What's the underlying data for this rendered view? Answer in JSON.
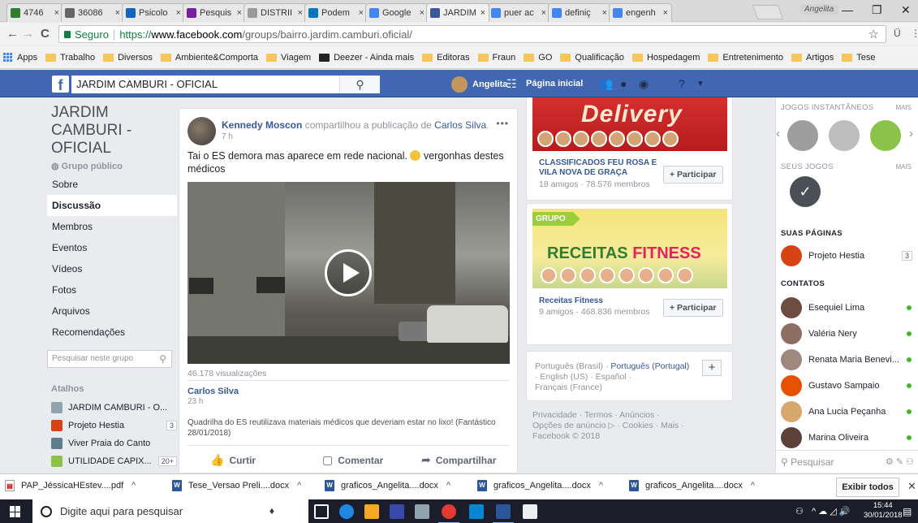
{
  "browser": {
    "tabs": [
      {
        "label": "4746",
        "color": "#2e7d32"
      },
      {
        "label": "36086",
        "color": "#666666"
      },
      {
        "label": "Psicolo",
        "color": "#1565c0"
      },
      {
        "label": "Pesquis",
        "color": "#7b1fa2"
      },
      {
        "label": "DISTRII",
        "color": "#999999"
      },
      {
        "label": "Podem",
        "color": "#0277bd"
      },
      {
        "label": "Google",
        "color": "#4285f4"
      },
      {
        "label": "JARDIM",
        "color": "#3b5998"
      },
      {
        "label": "puer ac",
        "color": "#4285f4"
      },
      {
        "label": "definiç",
        "color": "#4285f4"
      },
      {
        "label": "engenh",
        "color": "#4285f4"
      }
    ],
    "tab_close": "×",
    "profile_name": "Angelita",
    "window_controls": {
      "minimize": "—",
      "restore": "❐",
      "close": "✕"
    },
    "nav": {
      "back": "←",
      "forward": "→",
      "reload": "C"
    },
    "address": {
      "secure_label": "Seguro",
      "url_scheme": "https://",
      "url_host": "www.facebook.com",
      "url_path": "/groups/bairro.jardim.camburi.oficial/"
    },
    "bookmarks": [
      "Apps",
      "Trabalho",
      "Diversos",
      "Ambiente&Comporta",
      "Viagem",
      "Deezer - Ainda mais",
      "Editoras",
      "Fraun",
      "GO",
      "Qualificação",
      "Hospedagem",
      "Entretenimento",
      "Artigos",
      "Tese"
    ]
  },
  "fb": {
    "search_value": "JARDIM CAMBURI - OFICIAL",
    "user_name": "Angelita",
    "home_label": "Página inicial"
  },
  "group": {
    "title": "JARDIM CAMBURI - OFICIAL",
    "type": "Grupo público",
    "nav": [
      "Sobre",
      "Discussão",
      "Membros",
      "Eventos",
      "Vídeos",
      "Fotos",
      "Arquivos",
      "Recomendações"
    ],
    "selected_nav": "Discussão",
    "search_placeholder": "Pesquisar neste grupo",
    "shortcuts_title": "Atalhos",
    "shortcuts": [
      {
        "label": "JARDIM CAMBURI - O...",
        "badge": "",
        "color": "#90a4ae"
      },
      {
        "label": "Projeto Hestia",
        "badge": "3",
        "color": "#d84315"
      },
      {
        "label": "Viver Praia do Canto",
        "badge": "",
        "color": "#607d8b"
      },
      {
        "label": "UTILIDADE CAPIX...",
        "badge": "20+",
        "color": "#8bc34a"
      }
    ]
  },
  "post": {
    "author": "Kennedy Moscon",
    "action": "compartilhou a publicação de",
    "shared_from": "Carlos Silva",
    "time": "7 h",
    "more": "•••",
    "text_before": "Tai o ES demora mas aparece em rede nacional.",
    "text_after": "vergonhas destes médicos",
    "views": "46.178 visualizações",
    "orig_author": "Carlos Silva",
    "orig_time": "23 h",
    "orig_text": "Quadrilha do ES reutilizava materiais médicos que deveriam estar no lixo! (Fantástico 28/01/2018)",
    "actions": {
      "like": "Curtir",
      "comment": "Comentar",
      "share": "Compartilhar"
    }
  },
  "suggested": [
    {
      "name": "CLASSIFICADOS FEU ROSA E VILA NOVA DE GRAÇA",
      "meta": "18 amigos · 78.576 membros",
      "banner_text": "Delivery",
      "button": "+ Participar"
    },
    {
      "name": "Receitas Fitness",
      "meta": "9 amigos · 468.836 membros",
      "banner_tag": "GRUPO",
      "banner_text_a": "RECEITAS ",
      "banner_text_b": "FITNESS",
      "button": "+ Participar"
    }
  ],
  "languages": {
    "current": "Português (Brasil) ·",
    "line1_link": "Português (Portugal)",
    "line2": "· English (US) · Español ·",
    "line3": "Français (France)",
    "plus": "+"
  },
  "footer": {
    "line1": "Privacidade · Termos · Anúncios ·",
    "line2": "Opções de anúncio ▷ · Cookies · Mais ·",
    "line3": "Facebook © 2018"
  },
  "chat": {
    "games_title": "JOGOS INSTANTÂNEOS",
    "games_more": "MAIS",
    "my_games_title": "SEUS JOGOS",
    "my_games_more": "MAIS",
    "pages_title": "SUAS PÁGINAS",
    "pages": [
      {
        "name": "Projeto Hestia",
        "badge": "3",
        "color": "#d84315"
      }
    ],
    "contacts_title": "CONTATOS",
    "contacts": [
      {
        "name": "Esequiel Lima",
        "color": "#6d4c41"
      },
      {
        "name": "Valéria Nery",
        "color": "#8d6e63"
      },
      {
        "name": "Renata Maria Benevi...",
        "color": "#a1887f"
      },
      {
        "name": "Gustavo Sampaio",
        "color": "#e65100"
      },
      {
        "name": "Ana Lucia Peçanha",
        "color": "#d7a86e"
      },
      {
        "name": "Marina Oliveira",
        "color": "#5d4037"
      }
    ],
    "search_placeholder": "Pesquisar"
  },
  "downloads": {
    "items": [
      "PAP_JéssicaHEstev....pdf",
      "Tese_Versao Preli....docx",
      "graficos_Angelita....docx",
      "graficos_Angelita....docx",
      "graficos_Angelita....docx"
    ],
    "show_all": "Exibir todos",
    "close": "✕"
  },
  "taskbar": {
    "search_placeholder": "Digite aqui para pesquisar",
    "time": "15:44",
    "date": "30/01/2018"
  }
}
